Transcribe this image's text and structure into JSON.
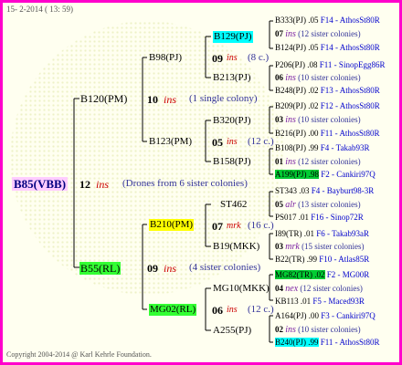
{
  "header": "15-  2-2014 ( 13: 59)",
  "footer": "Copyright 2004-2014 @ Karl Kehrle Foundation.",
  "root": {
    "name": "B85(VBB)",
    "gen": "12",
    "ins": "ins",
    "note": "(Drones from 6 sister colonies)"
  },
  "g1": {
    "top": {
      "name": "B120(PM)",
      "gen": "10",
      "ins": "ins",
      "note": "(1 single colony)"
    },
    "bot": {
      "name": "B55(RL)",
      "gen": "09",
      "ins": "ins",
      "note": "(4 sister colonies)"
    }
  },
  "g2": {
    "a": {
      "name": "B98(PJ)",
      "gen": "09",
      "ins": "ins",
      "note": "(8 c.)"
    },
    "b": {
      "name": "B123(PM)",
      "gen": "05",
      "ins": "ins",
      "note": "(12 c.)"
    },
    "c": {
      "name": "B210(PM)",
      "gen": "07",
      "ins": "mrk",
      "note": "(16 c.)"
    },
    "d": {
      "name": "MG02(RL)",
      "gen": "06",
      "ins": "ins",
      "note": "(12 c.)"
    }
  },
  "g3": {
    "a1": "B129(PJ)",
    "a2": "B213(PJ)",
    "b1": "B320(PJ)",
    "b2": "B158(PJ)",
    "c1": "ST462",
    "c2": "B19(MKK)",
    "d1": "MG10(MKK)",
    "d2": "A255(PJ)"
  },
  "g4": [
    {
      "name": "B333(PJ)",
      "val": ".05",
      "src": "F14 - AthosSt80R"
    },
    {
      "gen": "07",
      "ins": "ins",
      "note": "(12 sister colonies)"
    },
    {
      "name": "B124(PJ)",
      "val": ".05",
      "src": "F14 - AthosSt80R"
    },
    {
      "name": "P206(PJ)",
      "val": ".08",
      "src": "F11 - SinopEgg86R"
    },
    {
      "gen": "06",
      "ins": "ins",
      "note": "(10 sister colonies)"
    },
    {
      "name": "B248(PJ)",
      "val": ".02",
      "src": "F13 - AthosSt80R"
    },
    {
      "name": "B209(PJ)",
      "val": ".02",
      "src": "F12 - AthosSt80R"
    },
    {
      "gen": "03",
      "ins": "ins",
      "note": "(10 sister colonies)"
    },
    {
      "name": "B216(PJ)",
      "val": ".00",
      "src": "F11 - AthosSt80R"
    },
    {
      "name": "B108(PJ)",
      "val": ".99",
      "src": "F4 - Takab93R"
    },
    {
      "gen": "01",
      "ins": "ins",
      "note": "(12 sister colonies)"
    },
    {
      "name": "A199(PJ)",
      "val": ".98",
      "src": "F2 - Cankiri97Q"
    },
    {
      "name": "ST343",
      "val": ".03",
      "src": "F4 - Bayburt98-3R"
    },
    {
      "gen": "05",
      "ins": "alr",
      "note": "(13 sister colonies)"
    },
    {
      "name": "PS017",
      "val": ".01",
      "src": "F16 - Sinop72R"
    },
    {
      "name": "I89(TR)",
      "val": ".01",
      "src": "F6 - Takab93aR"
    },
    {
      "gen": "03",
      "ins": "mrk",
      "note": "(15 sister colonies)"
    },
    {
      "name": "B22(TR)",
      "val": ".99",
      "src": "F10 - Atlas85R"
    },
    {
      "name": "MG82(TR)",
      "val": ".02",
      "src": "F2 - MG00R"
    },
    {
      "gen": "04",
      "ins": "nex",
      "note": "(12 sister colonies)"
    },
    {
      "name": "KB113",
      "val": ".01",
      "src": "F5 - Maced93R"
    },
    {
      "name": "A164(PJ)",
      "val": ".00",
      "src": "F3 - Cankiri97Q"
    },
    {
      "gen": "02",
      "ins": "ins",
      "note": "(10 sister colonies)"
    },
    {
      "name": "B240(PJ)",
      "val": ".99",
      "src": "F11 - AthosSt80R"
    }
  ]
}
